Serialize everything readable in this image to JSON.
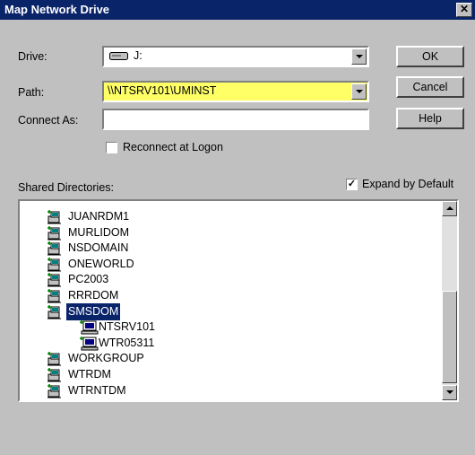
{
  "window": {
    "title": "Map Network Drive",
    "close_glyph": "✕"
  },
  "fields": {
    "drive_label": "Drive:",
    "drive_value": "J:",
    "path_label": "Path:",
    "path_value": "\\\\NTSRV101\\UMINST",
    "connect_as_label": "Connect As:",
    "connect_as_value": ""
  },
  "reconnect": {
    "label": "Reconnect at Logon",
    "checked": false
  },
  "buttons": {
    "ok": "OK",
    "cancel": "Cancel",
    "help": "Help"
  },
  "shared": {
    "label": "Shared Directories:",
    "expand_label": "Expand by Default",
    "expand_checked": true,
    "check_glyph": "✓",
    "items": [
      {
        "name": "JUANRDM1",
        "type": "domain-icon",
        "level": 0,
        "selected": false
      },
      {
        "name": "MURLIDOM",
        "type": "domain-icon",
        "level": 0,
        "selected": false
      },
      {
        "name": "NSDOMAIN",
        "type": "domain-icon",
        "level": 0,
        "selected": false
      },
      {
        "name": "ONEWORLD",
        "type": "domain-icon",
        "level": 0,
        "selected": false
      },
      {
        "name": "PC2003",
        "type": "domain-icon",
        "level": 0,
        "selected": false
      },
      {
        "name": "RRRDOM",
        "type": "domain-icon",
        "level": 0,
        "selected": false
      },
      {
        "name": "SMSDOM",
        "type": "domain-icon",
        "level": 0,
        "selected": true
      },
      {
        "name": "NTSRV101",
        "type": "computer-icon",
        "level": 1,
        "selected": false
      },
      {
        "name": "WTR05311",
        "type": "computer-icon",
        "level": 1,
        "selected": false
      },
      {
        "name": "WORKGROUP",
        "type": "domain-icon",
        "level": 0,
        "selected": false
      },
      {
        "name": "WTRDM",
        "type": "domain-icon",
        "level": 0,
        "selected": false
      },
      {
        "name": "WTRNTDM",
        "type": "domain-icon",
        "level": 0,
        "selected": false
      }
    ]
  },
  "colors": {
    "path_highlight": "#ffff66",
    "selection": "#0a246a",
    "titlebar": "#0a246a"
  }
}
